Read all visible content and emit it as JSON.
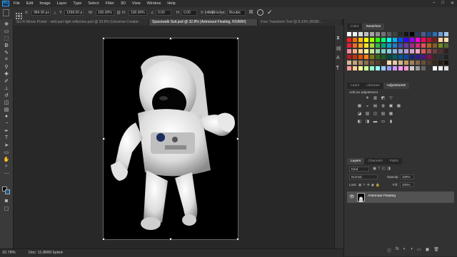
{
  "app": {
    "logo": "Ps"
  },
  "menu": [
    "File",
    "Edit",
    "Image",
    "Layer",
    "Type",
    "Select",
    "Filter",
    "3D",
    "View",
    "Window",
    "Help"
  ],
  "window_controls": [
    "–",
    "□",
    "✕"
  ],
  "options": {
    "x_label": "X:",
    "x_value": "984.00 px",
    "y_label": "Y:",
    "y_value": "1298.00 p",
    "w_label": "W:",
    "w_value": "100.00%",
    "h_label": "H:",
    "h_value": "100.00%",
    "angle_value": "0.00",
    "hskew_label": "H:",
    "hskew_value": "0.00",
    "vskew_label": "V:",
    "vskew_value": "0.00",
    "interp_label": "Interpolation:",
    "interp_value": "Bicubic"
  },
  "tabs": [
    {
      "title": "Sci Fi Movie Poster - wild part light reflection.psd @ 33.6% (Universe-Creator-8_R...",
      "active": false
    },
    {
      "title": "Spacewalk Suit.psd @ 32.8% (Astronaut Floating, RGB/8#)",
      "active": true
    },
    {
      "title": "Free Transform Tool @ 8.33% (RGB/...",
      "active": false
    }
  ],
  "status": {
    "zoom": "32.78%",
    "doc": "Doc: 11.8M/0 bytes"
  },
  "panels": {
    "color_tabs": [
      "Color",
      "Swatches"
    ],
    "adjust_tabs": [
      "Learn",
      "Libraries",
      "Adjustments"
    ],
    "add_adjustment": "Add an adjustment",
    "layers_tabs": [
      "Layers",
      "Channels",
      "Paths"
    ],
    "kind_label": "Kind",
    "blend_mode": "Normal",
    "opacity_label": "Opacity:",
    "opacity_value": "100%",
    "lock_label": "Lock:",
    "fill_label": "Fill:",
    "fill_value": "100%",
    "layer_name": "Astronaut Floating",
    "layer_footer": [
      "ⓒ",
      "fx",
      "◐",
      "◑",
      "▭",
      "▣",
      "🗑"
    ]
  },
  "swatch_colors": [
    [
      "#ffffff",
      "#f0f0f0",
      "#d8d8d8",
      "#bebebe",
      "#a5a5a5",
      "#8c8c8c",
      "#737373",
      "#5a5a5a",
      "#414141",
      "#282828",
      "#141414",
      "#000000",
      "#2a3a5a",
      "#4a5a8a",
      "#1d4d8a",
      "#2e6db5",
      "#6a9ad4",
      "#a0c4e8"
    ],
    [
      "#ff1b1b",
      "#ff6a00",
      "#ffc000",
      "#ffff00",
      "#9dff00",
      "#2bff00",
      "#00ff7a",
      "#00fff0",
      "#00b4ff",
      "#0050ff",
      "#3a00ff",
      "#9600ff",
      "#ff00d8",
      "#ff0066",
      "#c8102e",
      "#7a1a1a",
      "#ffd0a0",
      "#f7e0b0"
    ],
    [
      "#e8203a",
      "#f26a2a",
      "#f7a81b",
      "#f9e12d",
      "#a5d63a",
      "#36b44a",
      "#00a67e",
      "#00a3c8",
      "#2a79c2",
      "#3b4fa8",
      "#6a3aa0",
      "#9e2c8c",
      "#d92b7a",
      "#e64a5f",
      "#b5651d",
      "#8b5a2b",
      "#6b8e23",
      "#556b2f"
    ],
    [
      "#f48fa0",
      "#f8b08a",
      "#fbd58a",
      "#fcf29a",
      "#c9e59a",
      "#93d5a4",
      "#7fcfc0",
      "#86cde3",
      "#8fb3e0",
      "#9aa3d6",
      "#b89ad0",
      "#d79fce",
      "#f1a7c6",
      "#d35f5f",
      "#a05050",
      "#704040",
      "#503030",
      "#302020"
    ],
    [
      "#b71c1c",
      "#bf360c",
      "#e65100",
      "#f57f17",
      "#827717",
      "#33691e",
      "#1b5e20",
      "#004d40",
      "#006064",
      "#01579b",
      "#0d47a1",
      "#1a237e",
      "#311b92",
      "#4a148c",
      "#880e4f",
      "#3e2723",
      "#263238",
      "#212121"
    ],
    [
      "#d4b896",
      "#c4a27a",
      "#a88862",
      "#8c6e4e",
      "#70563c",
      "#54402c",
      "#3a2c1e",
      "#f5deb3",
      "#e6c9a0",
      "#d2b48c",
      "#bc9a6c",
      "#a0825a",
      "#846848",
      "#6a5038",
      "#50392a",
      "#38281c",
      "#261a12",
      "#140e0a"
    ],
    [
      "#ff9999",
      "#ffcc99",
      "#ffff99",
      "#ccff99",
      "#99ffcc",
      "#99ffff",
      "#99ccff",
      "#9999ff",
      "#cc99ff",
      "#ff99ff",
      "#ff99cc",
      "#cccccc",
      "#999999",
      "#666666",
      "#333333",
      "#ffffff",
      "#eeeeee",
      "#dddddd"
    ]
  ],
  "adjust_icons": [
    [
      "☀",
      "▥",
      "◩",
      "▽"
    ],
    [
      "▦",
      "◒",
      "▤",
      "◍",
      "▣",
      "▦"
    ],
    [
      "◪",
      "▧",
      "◫",
      "▨",
      "▩"
    ],
    [
      "◧",
      "◨",
      "▬",
      "▭",
      "▮"
    ]
  ]
}
